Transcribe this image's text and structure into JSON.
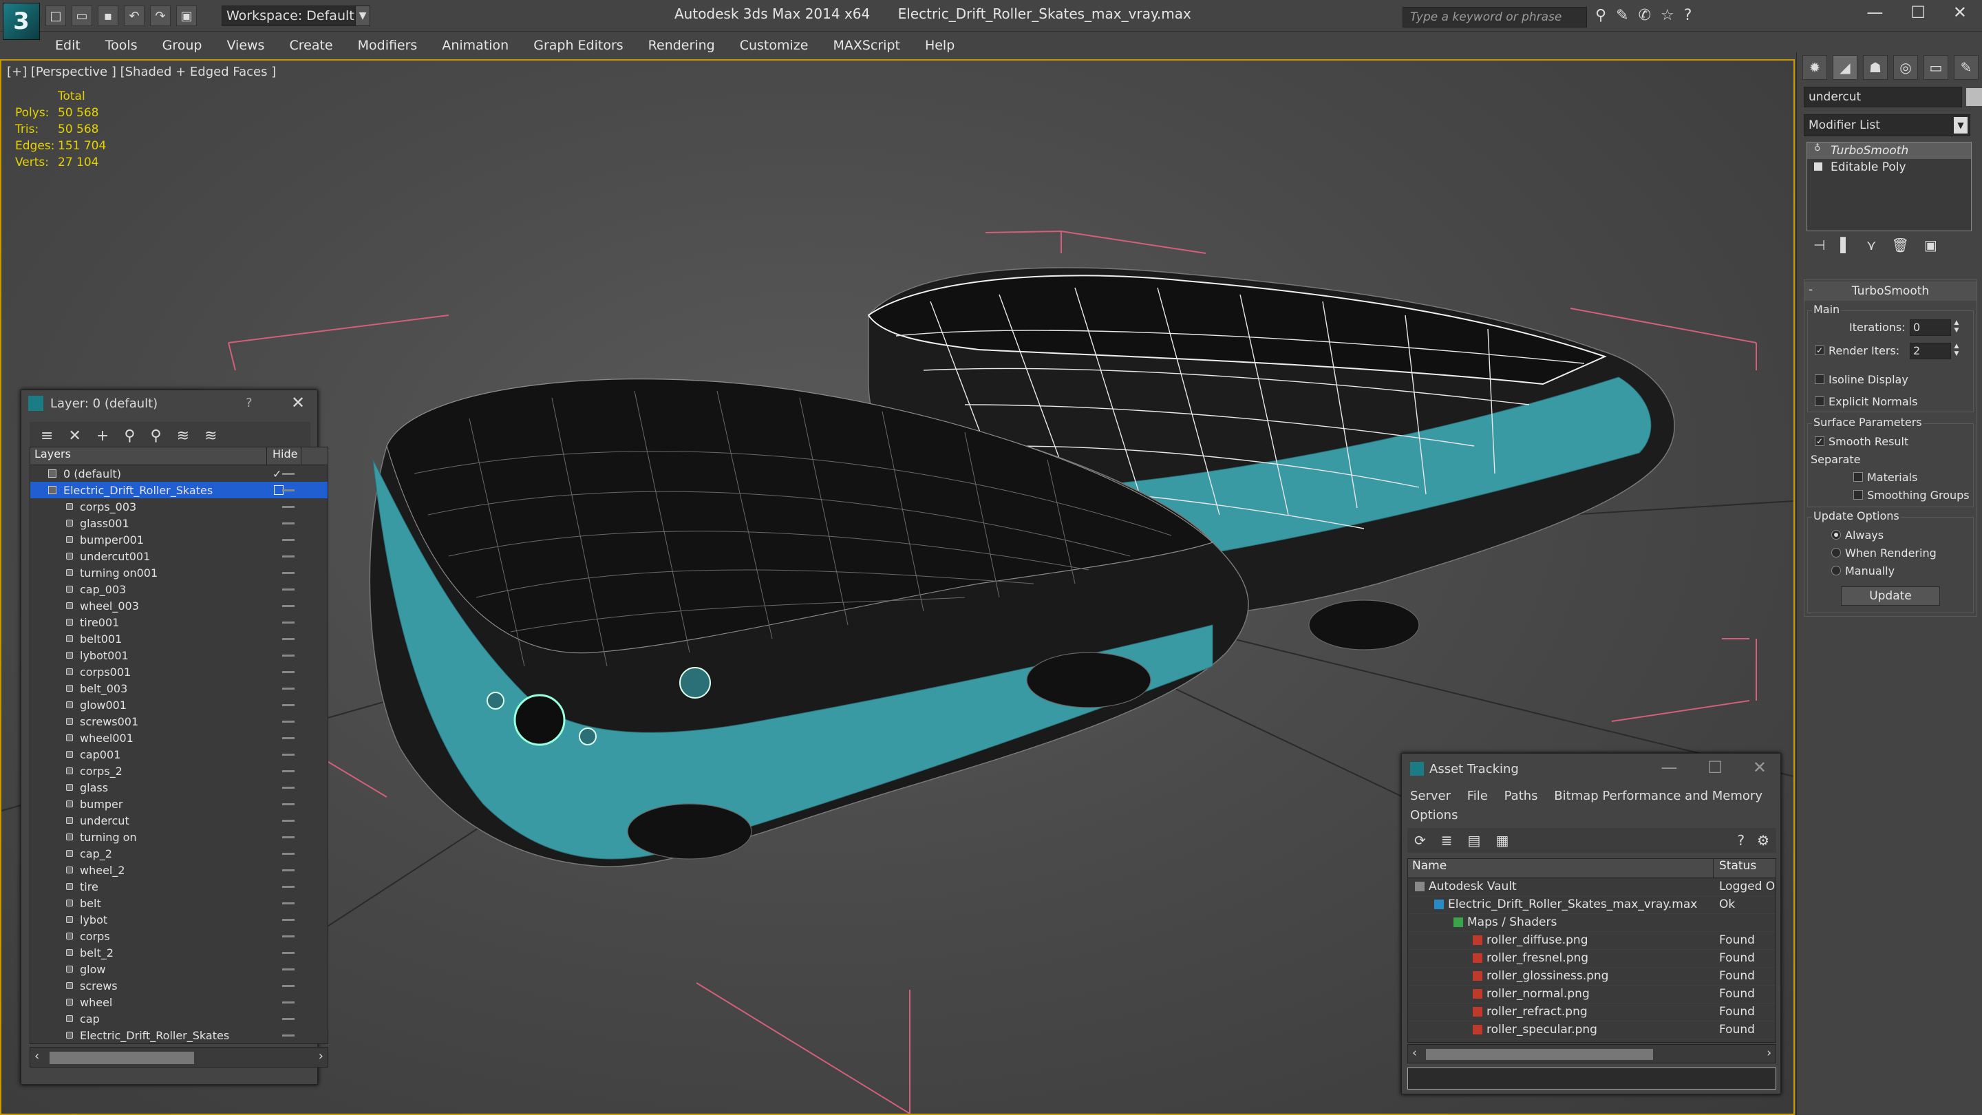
{
  "app": {
    "title": "Autodesk 3ds Max  2014 x64",
    "filename": "Electric_Drift_Roller_Skates_max_vray.max",
    "logo": "3",
    "workspace": "Workspace: Default",
    "search_placeholder": "Type a keyword or phrase",
    "accent": "#1a7d86"
  },
  "menu": [
    "Edit",
    "Tools",
    "Group",
    "Views",
    "Create",
    "Modifiers",
    "Animation",
    "Graph Editors",
    "Rendering",
    "Customize",
    "MAXScript",
    "Help"
  ],
  "viewport": {
    "label": "[+] [Perspective ] [Shaded + Edged Faces ]",
    "stats": {
      "total": "Total",
      "rows": [
        {
          "k": "Polys:",
          "v": "50 568"
        },
        {
          "k": "Tris:",
          "v": "50 568"
        },
        {
          "k": "Edges:",
          "v": "151 704"
        },
        {
          "k": "Verts:",
          "v": "27 104"
        }
      ]
    },
    "model_color": "#3a9aa4"
  },
  "layer_panel": {
    "title": "Layer: 0 (default)",
    "help": "?",
    "col_layers": "Layers",
    "col_hide": "Hide",
    "default_layer": "0 (default)",
    "selected_layer": "Electric_Drift_Roller_Skates",
    "objects": [
      "corps_003",
      "glass001",
      "bumper001",
      "undercut001",
      "turning on001",
      "cap_003",
      "wheel_003",
      "tire001",
      "belt001",
      "lybot001",
      "corps001",
      "belt_003",
      "glow001",
      "screws001",
      "wheel001",
      "cap001",
      "corps_2",
      "glass",
      "bumper",
      "undercut",
      "turning on",
      "cap_2",
      "wheel_2",
      "tire",
      "belt",
      "lybot",
      "corps",
      "belt_2",
      "glow",
      "screws",
      "wheel",
      "cap",
      "Electric_Drift_Roller_Skates"
    ]
  },
  "asset_tracking": {
    "title": "Asset Tracking",
    "menu": [
      "Server",
      "File",
      "Paths",
      "Bitmap Performance and Memory",
      "Options"
    ],
    "col_name": "Name",
    "col_status": "Status",
    "rows": [
      {
        "name": "Autodesk Vault",
        "status": "Logged O",
        "indent": 0
      },
      {
        "name": "Electric_Drift_Roller_Skates_max_vray.max",
        "status": "Ok",
        "indent": 1
      },
      {
        "name": "Maps / Shaders",
        "status": "",
        "indent": 2
      },
      {
        "name": "roller_diffuse.png",
        "status": "Found",
        "indent": 3
      },
      {
        "name": "roller_fresnel.png",
        "status": "Found",
        "indent": 3
      },
      {
        "name": "roller_glossiness.png",
        "status": "Found",
        "indent": 3
      },
      {
        "name": "roller_normal.png",
        "status": "Found",
        "indent": 3
      },
      {
        "name": "roller_refract.png",
        "status": "Found",
        "indent": 3
      },
      {
        "name": "roller_specular.png",
        "status": "Found",
        "indent": 3
      }
    ]
  },
  "command_panel": {
    "object_name": "undercut",
    "modifier_list": "Modifier List",
    "stack": [
      "TurboSmooth",
      "Editable Poly"
    ],
    "rollout_title": "TurboSmooth",
    "main_label": "Main",
    "iterations_label": "Iterations:",
    "iterations_value": "0",
    "render_iters_label": "Render Iters:",
    "render_iters_value": "2",
    "render_iters_checked": true,
    "isoline": "Isoline Display",
    "explicit_normals": "Explicit Normals",
    "surface_params": "Surface Parameters",
    "smooth_result": "Smooth Result",
    "smooth_result_checked": true,
    "separate": "Separate",
    "materials": "Materials",
    "smoothing_groups": "Smoothing Groups",
    "update_options": "Update Options",
    "always": "Always",
    "when_rendering": "When Rendering",
    "manually": "Manually",
    "update_button": "Update"
  }
}
